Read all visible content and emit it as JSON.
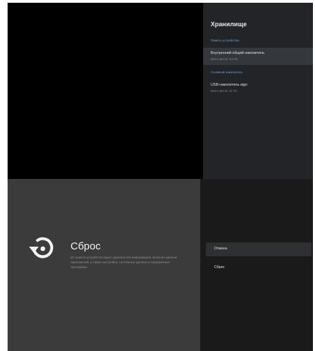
{
  "storage": {
    "title": "Хранилище",
    "sections": [
      {
        "header": "Память устройства",
        "items": [
          {
            "name": "Внутренний общий накопитель",
            "sub": "Всего места: 3,6 ГБ",
            "focused": true
          }
        ]
      },
      {
        "header": "Съемный накопитель",
        "items": [
          {
            "name": "USB-накопитель aigo",
            "sub": "Всего места: 31 ГБ",
            "focused": false
          }
        ]
      }
    ]
  },
  "reset": {
    "icon": "restore-icon",
    "title": "Сброс",
    "description": "Из памяти устройства будет удалена вся информация, включая данные приложений, а также настройки, системные данные и загруженные программы."
  },
  "actions": {
    "items": [
      {
        "label": "Отмена",
        "focused": true
      },
      {
        "label": "Сброс",
        "focused": false
      }
    ]
  },
  "colors": {
    "accent": "#6e9fd8",
    "panel_dark": "#222428",
    "reset_bg": "#3b3b3b",
    "actions_bg": "#1a1a1a"
  }
}
